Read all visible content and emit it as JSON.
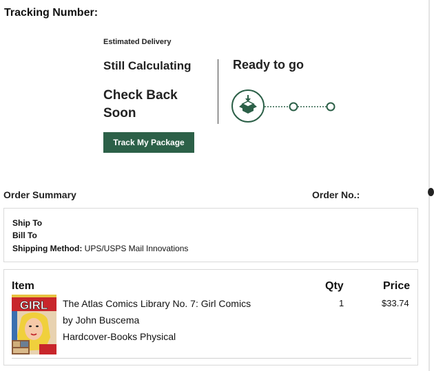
{
  "tracking": {
    "title": "Tracking Number:"
  },
  "delivery": {
    "estimated_label": "Estimated Delivery",
    "status_primary": "Still Calculating",
    "status_secondary": "Check Back Soon",
    "track_button_label": "Track My Package"
  },
  "progress": {
    "status_label": "Ready to go",
    "steps_total": 3,
    "current_step": 1,
    "accent_color": "#2c6048",
    "icon": "package-box-icon"
  },
  "summary": {
    "title": "Order Summary",
    "order_no_label": "Order No.:"
  },
  "shipping": {
    "ship_to_label": "Ship To",
    "bill_to_label": "Bill To",
    "method_label": "Shipping Method:",
    "method_value": "UPS/USPS Mail Innovations"
  },
  "items": {
    "header_item": "Item",
    "header_qty": "Qty",
    "header_price": "Price",
    "rows": [
      {
        "title": "The Atlas Comics Library No. 7: Girl Comics",
        "author": "by John Buscema",
        "format": "Hardcover-Books Physical",
        "qty": "1",
        "price": "$33.74",
        "cover_text": "GIRL"
      }
    ]
  }
}
